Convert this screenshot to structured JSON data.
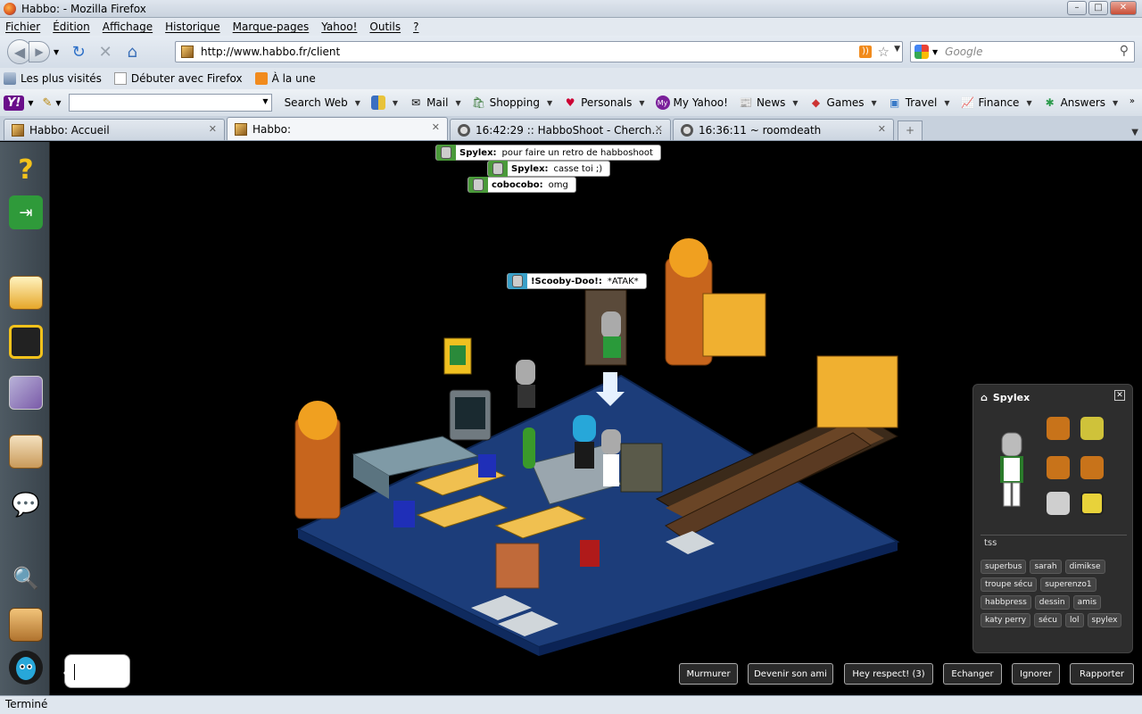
{
  "window": {
    "title": "Habbo: - Mozilla Firefox"
  },
  "menu": [
    "Fichier",
    "Édition",
    "Affichage",
    "Historique",
    "Marque-pages",
    "Yahoo!",
    "Outils",
    "?"
  ],
  "nav": {
    "url": "http://www.habbo.fr/client",
    "search_placeholder": "Google"
  },
  "bookmarks": [
    "Les plus visités",
    "Débuter avec Firefox",
    "À la une"
  ],
  "yahoo": {
    "logo": "Y!",
    "search_web": "Search Web",
    "items": [
      "Mail",
      "Shopping",
      "Personals",
      "My Yahoo!",
      "News",
      "Games",
      "Travel",
      "Finance",
      "Answers"
    ]
  },
  "tabs": [
    {
      "label": "Habbo: Accueil"
    },
    {
      "label": "Habbo:"
    },
    {
      "label": "16:42:29 :: HabboShoot - Cherche o..."
    },
    {
      "label": "16:36:11 ~ roomdeath"
    }
  ],
  "chat": [
    {
      "user": "Spylex:",
      "text": "pour faire un retro de habboshoot"
    },
    {
      "user": "Spylex:",
      "text": "casse toi ;)"
    },
    {
      "user": "cobocobo:",
      "text": "omg"
    },
    {
      "user": "!Scooby-Doo!:",
      "text": "*ATAK*"
    }
  ],
  "infostand": {
    "name": "Spylex",
    "motto": "tss",
    "tags": [
      "superbus",
      "sarah",
      "dimikse",
      "troupe sécu",
      "superenzo1",
      "habbpress",
      "dessin",
      "amis",
      "katy perry",
      "sécu",
      "lol",
      "spylex"
    ]
  },
  "actions": [
    "Murmurer",
    "Devenir son ami",
    "Hey respect! (3)",
    "Echanger",
    "Ignorer",
    "Rapporter"
  ],
  "status": "Terminé",
  "colors": {
    "room_floor": "#1e3f7a",
    "chrome": "#dfe6ee",
    "habbo_gold": "#f0a020"
  }
}
